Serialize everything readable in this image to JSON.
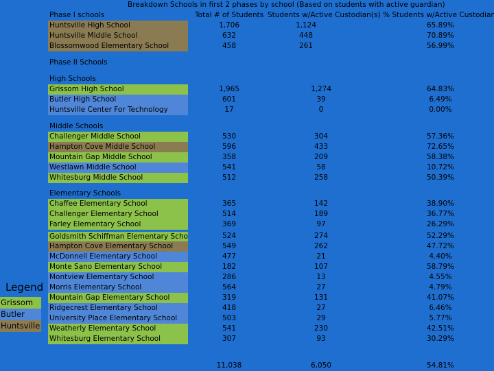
{
  "title": "Breakdown Schools in first 2 phases by school (Based on students with active guardian)",
  "headers": {
    "phase1": "Phase I schools",
    "total": "Total # of Students",
    "active": "Students w/Active Custodian(s)",
    "pct": "% Students w/Active Custodian(s)"
  },
  "phase2_label": "Phase II Schools",
  "high_label": "High Schools",
  "middle_label": "Middle Schools",
  "elem_label": "Elementary Schools",
  "colors": {
    "grissom": "#8cc24a",
    "butler": "#4f86d8",
    "huntsville": "#8b7b52",
    "background": "#1f6fd0"
  },
  "rows": [
    [
      "Huntsville High School",
      "1,706",
      "1,124",
      "65.89%"
    ],
    [
      "Huntsville Middle School",
      "632",
      "448",
      "70.89%"
    ],
    [
      "Blossomwood Elementary School",
      "458",
      "261",
      "56.99%"
    ],
    [
      "Grissom High School",
      "1,965",
      "1,274",
      "64.83%"
    ],
    [
      "Butler High School",
      "601",
      "39",
      "6.49%"
    ],
    [
      "Huntsville Center For Technology",
      "17",
      "0",
      "0.00%"
    ],
    [
      "Challenger Middle School",
      "530",
      "304",
      "57.36%"
    ],
    [
      "Hampton Cove Middle School",
      "596",
      "433",
      "72.65%"
    ],
    [
      "Mountain Gap Middle School",
      "358",
      "209",
      "58.38%"
    ],
    [
      "Westlawn Middle School",
      "541",
      "58",
      "10.72%"
    ],
    [
      "Whitesburg Middle School",
      "512",
      "258",
      "50.39%"
    ],
    [
      "Chaffee Elementary School",
      "365",
      "142",
      "38.90%"
    ],
    [
      "Challenger Elementary School",
      "514",
      "189",
      "36.77%"
    ],
    [
      "Farley Elementary School",
      "369",
      "97",
      "26.29%"
    ],
    [
      "Goldsmith Schiffman Elementary School",
      "524",
      "274",
      "52.29%"
    ],
    [
      "Hampton Cove Elementary School",
      "549",
      "262",
      "47.72%"
    ],
    [
      "McDonnell Elementary School",
      "477",
      "21",
      "4.40%"
    ],
    [
      "Monte Sano Elementary School",
      "182",
      "107",
      "58.79%"
    ],
    [
      "Montview Elementary School",
      "286",
      "13",
      "4.55%"
    ],
    [
      "Morris Elementary School",
      "564",
      "27",
      "4.79%"
    ],
    [
      "Mountain Gap Elementary School",
      "319",
      "131",
      "41.07%"
    ],
    [
      "Ridgecrest Elementary School",
      "418",
      "27",
      "6.46%"
    ],
    [
      "University Place Elementary School",
      "503",
      "29",
      "5.77%"
    ],
    [
      "Weatherly Elementary School",
      "541",
      "230",
      "42.51%"
    ],
    [
      "Whitesburg Elementary School",
      "307",
      "93",
      "30.29%"
    ]
  ],
  "totals": [
    "11,038",
    "6,050",
    "54.81%"
  ],
  "legend": {
    "title": "Legend",
    "items": [
      "Grissom",
      "Butler",
      "Huntsville"
    ]
  }
}
